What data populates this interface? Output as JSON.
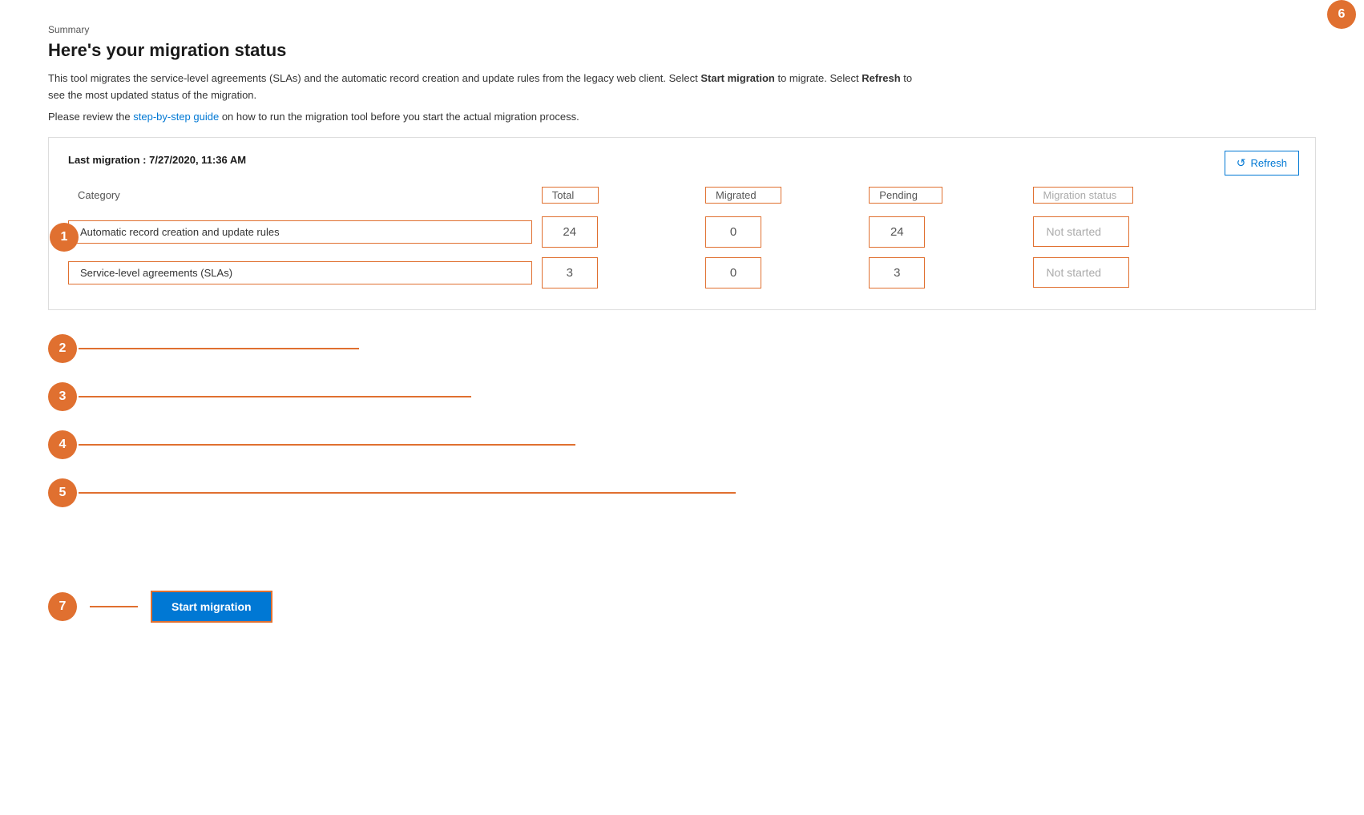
{
  "page": {
    "summary_label": "Summary",
    "title": "Here's your migration status",
    "description": "This tool migrates the service-level agreements (SLAs) and the automatic record creation and update rules from the legacy web client. Select",
    "bold1": "Start migration",
    "description2": "to migrate. Select",
    "bold2": "Refresh",
    "description3": "to see the most updated status of the migration.",
    "guide_prefix": "Please review the",
    "guide_link": "step-by-step guide",
    "guide_suffix": "on how to run the migration tool before you start the actual migration process.",
    "last_migration": "Last migration : 7/27/2020, 11:36 AM",
    "refresh_label": "Refresh",
    "table": {
      "col_category": "Category",
      "col_total": "Total",
      "col_migrated": "Migrated",
      "col_pending": "Pending",
      "col_status": "Migration status",
      "rows": [
        {
          "category": "Automatic record creation and update rules",
          "total": "24",
          "migrated": "0",
          "pending": "24",
          "status": "Not started"
        },
        {
          "category": "Service-level agreements (SLAs)",
          "total": "3",
          "migrated": "0",
          "pending": "3",
          "status": "Not started"
        }
      ]
    },
    "start_migration_label": "Start migration",
    "annotations": [
      "1",
      "2",
      "3",
      "4",
      "5",
      "6",
      "7"
    ]
  }
}
